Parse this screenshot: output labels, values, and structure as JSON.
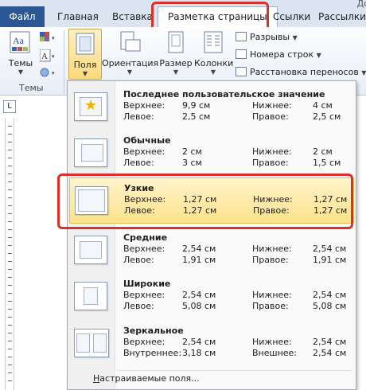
{
  "tabs": {
    "file": "Файл",
    "home": "Главная",
    "insert": "Вставка",
    "layout": "Разметка страницы",
    "links": "Ссылки",
    "mailings": "Рассылки",
    "cut_right": "До"
  },
  "ribbon": {
    "themes_label": "Темы",
    "themes_group": "Темы",
    "fields_label": "Поля",
    "orientation_label": "Ориентация",
    "size_label": "Размер",
    "columns_label": "Колонки",
    "breaks_label": "Разрывы",
    "line_numbers_label": "Номера строк",
    "hyphenation_label": "Расстановка переносов"
  },
  "ruler": {
    "corner": "L"
  },
  "presets": [
    {
      "name": "Последнее пользовательское значение",
      "top_label": "Верхнее:",
      "top": "9,9 см",
      "bottom_label": "Нижнее:",
      "bottom": "4 см",
      "left_label": "Левое:",
      "left": "2,5 см",
      "right_label": "Правое:",
      "right": "2,5 см"
    },
    {
      "name": "Обычные",
      "top_label": "Верхнее:",
      "top": "2 см",
      "bottom_label": "Нижнее:",
      "bottom": "2 см",
      "left_label": "Левое:",
      "left": "3 см",
      "right_label": "Правое:",
      "right": "1,5 см"
    },
    {
      "name": "Узкие",
      "top_label": "Верхнее:",
      "top": "1,27 см",
      "bottom_label": "Нижнее:",
      "bottom": "1,27 см",
      "left_label": "Левое:",
      "left": "1,27 см",
      "right_label": "Правое:",
      "right": "1,27 см"
    },
    {
      "name": "Средние",
      "top_label": "Верхнее:",
      "top": "2,54 см",
      "bottom_label": "Нижнее:",
      "bottom": "2,54 см",
      "left_label": "Левое:",
      "left": "1,91 см",
      "right_label": "Правое:",
      "right": "1,91 см"
    },
    {
      "name": "Широкие",
      "top_label": "Верхнее:",
      "top": "2,54 см",
      "bottom_label": "Нижнее:",
      "bottom": "2,54 см",
      "left_label": "Левое:",
      "left": "5,08 см",
      "right_label": "Правое:",
      "right": "5,08 см"
    },
    {
      "name": "Зеркальное",
      "top_label": "Верхнее:",
      "top": "2,54 см",
      "bottom_label": "Нижнее:",
      "bottom": "2,54 см",
      "left_label": "Внутреннее:",
      "left": "3,18 см",
      "right_label": "Внешнее:",
      "right": "2,54 см"
    }
  ],
  "custom_margins": {
    "underlined": "Н",
    "rest": "астраиваемые поля..."
  },
  "colors": {
    "file_tab": "#2b5797",
    "annotation": "#d7332b",
    "selected": "#fde28a"
  }
}
